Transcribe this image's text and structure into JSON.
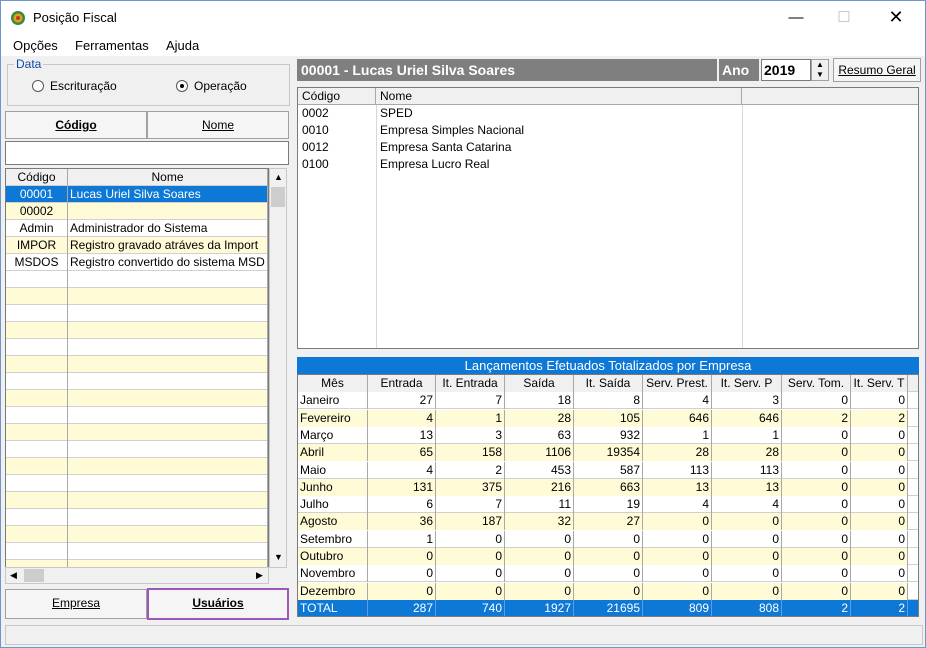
{
  "window": {
    "title": "Posição Fiscal"
  },
  "menu": [
    "Opções",
    "Ferramentas",
    "Ajuda"
  ],
  "data_group": {
    "legend": "Data",
    "options": [
      {
        "label": "Escrituração",
        "selected": false
      },
      {
        "label": "Operação",
        "selected": true
      }
    ]
  },
  "left_tabs": {
    "codigo": "Código",
    "nome": "Nome"
  },
  "left_grid": {
    "headers": [
      "Código",
      "Nome"
    ],
    "rows": [
      {
        "codigo": "00001",
        "nome": "Lucas Uriel Silva Soares",
        "state": "selected"
      },
      {
        "codigo": "00002",
        "nome": "",
        "state": "yellow"
      },
      {
        "codigo": "Admin",
        "nome": "Administrador do Sistema",
        "state": "white"
      },
      {
        "codigo": "IMPOR",
        "nome": "Registro gravado atráves da Import",
        "state": "yellow"
      },
      {
        "codigo": "MSDOS",
        "nome": "Registro convertido do sistema MSD",
        "state": "white"
      }
    ]
  },
  "bottom_tabs": {
    "empresa": "Empresa",
    "usuarios": "Usuários"
  },
  "right_header": {
    "user": "00001 - Lucas Uriel Silva Soares",
    "ano_label": "Ano",
    "ano_value": "2019",
    "resumo_button": "Resumo Geral"
  },
  "empresas_grid": {
    "headers": [
      "Código",
      "Nome"
    ],
    "rows": [
      {
        "codigo": "0002",
        "nome": "SPED"
      },
      {
        "codigo": "0010",
        "nome": "Empresa Simples Nacional"
      },
      {
        "codigo": "0012",
        "nome": "Empresa Santa Catarina"
      },
      {
        "codigo": "0100",
        "nome": "Empresa Lucro Real"
      }
    ]
  },
  "lancamentos": {
    "title": "Lançamentos Efetuados Totalizados por Empresa",
    "headers": [
      "Mês",
      "Entrada",
      "It. Entrada",
      "Saída",
      "It. Saída",
      "Serv. Prest.",
      "It. Serv. P",
      "Serv. Tom.",
      "It. Serv. T"
    ],
    "rows": [
      [
        "Janeiro",
        "27",
        "7",
        "18",
        "8",
        "4",
        "3",
        "0",
        "0"
      ],
      [
        "Fevereiro",
        "4",
        "1",
        "28",
        "105",
        "646",
        "646",
        "2",
        "2"
      ],
      [
        "Março",
        "13",
        "3",
        "63",
        "932",
        "1",
        "1",
        "0",
        "0"
      ],
      [
        "Abril",
        "65",
        "158",
        "1106",
        "19354",
        "28",
        "28",
        "0",
        "0"
      ],
      [
        "Maio",
        "4",
        "2",
        "453",
        "587",
        "113",
        "113",
        "0",
        "0"
      ],
      [
        "Junho",
        "131",
        "375",
        "216",
        "663",
        "13",
        "13",
        "0",
        "0"
      ],
      [
        "Julho",
        "6",
        "7",
        "11",
        "19",
        "4",
        "4",
        "0",
        "0"
      ],
      [
        "Agosto",
        "36",
        "187",
        "32",
        "27",
        "0",
        "0",
        "0",
        "0"
      ],
      [
        "Setembro",
        "1",
        "0",
        "0",
        "0",
        "0",
        "0",
        "0",
        "0"
      ],
      [
        "Outubro",
        "0",
        "0",
        "0",
        "0",
        "0",
        "0",
        "0",
        "0"
      ],
      [
        "Novembro",
        "0",
        "0",
        "0",
        "0",
        "0",
        "0",
        "0",
        "0"
      ],
      [
        "Dezembro",
        "0",
        "0",
        "0",
        "0",
        "0",
        "0",
        "0",
        "0"
      ]
    ],
    "total": [
      "TOTAL",
      "287",
      "740",
      "1927",
      "21695",
      "809",
      "808",
      "2",
      "2"
    ]
  }
}
